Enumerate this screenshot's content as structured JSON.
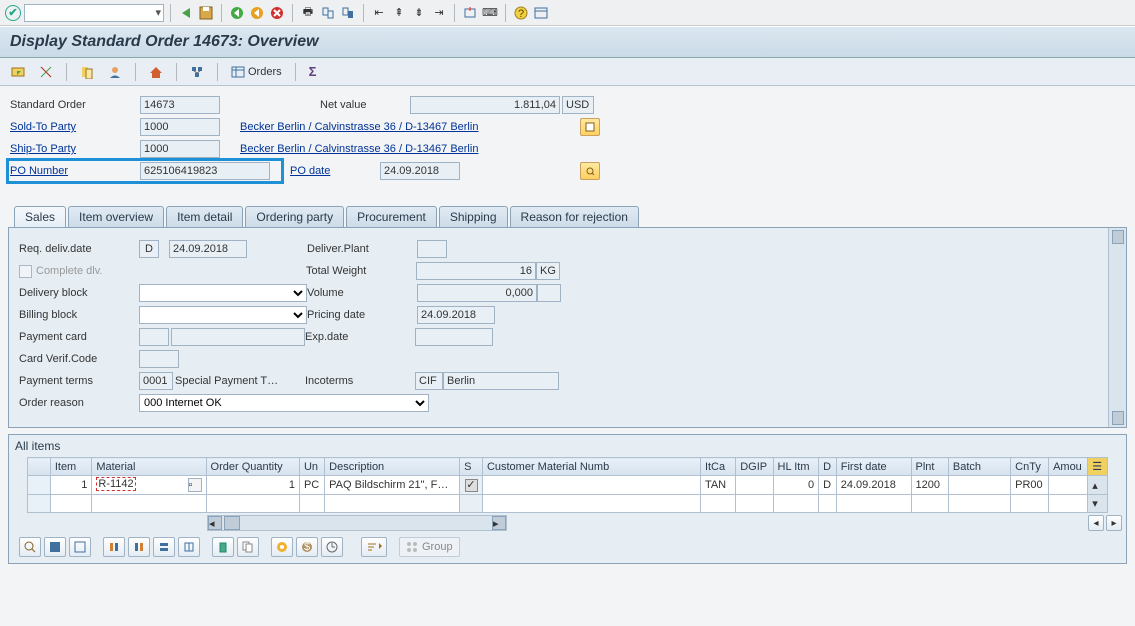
{
  "title": "Display Standard Order 14673: Overview",
  "toolbar": {
    "orders_label": "Orders"
  },
  "header": {
    "standard_order_label": "Standard Order",
    "standard_order_value": "14673",
    "net_value_label": "Net value",
    "net_value_value": "1.811,04",
    "currency": "USD",
    "sold_to_label": "Sold-To Party",
    "sold_to_value": "1000",
    "sold_to_text": "Becker Berlin / Calvinstrasse 36 / D-13467 Berlin",
    "ship_to_label": "Ship-To Party",
    "ship_to_value": "1000",
    "ship_to_text": "Becker Berlin / Calvinstrasse 36 / D-13467 Berlin",
    "po_number_label": "PO Number",
    "po_number_value": "625106419823",
    "po_date_label": "PO date",
    "po_date_value": "24.09.2018"
  },
  "tabs": [
    "Sales",
    "Item overview",
    "Item detail",
    "Ordering party",
    "Procurement",
    "Shipping",
    "Reason for rejection"
  ],
  "sales": {
    "req_deliv_label": "Req. deliv.date",
    "req_deliv_rule": "D",
    "req_deliv_date": "24.09.2018",
    "deliver_plant_label": "Deliver.Plant",
    "complete_dlv_label": "Complete dlv.",
    "total_weight_label": "Total Weight",
    "total_weight_value": "16",
    "total_weight_unit": "KG",
    "delivery_block_label": "Delivery block",
    "volume_label": "Volume",
    "volume_value": "0,000",
    "billing_block_label": "Billing block",
    "pricing_date_label": "Pricing date",
    "pricing_date_value": "24.09.2018",
    "payment_card_label": "Payment card",
    "exp_date_label": "Exp.date",
    "card_verif_label": "Card Verif.Code",
    "payment_terms_label": "Payment terms",
    "payment_terms_value": "0001",
    "payment_terms_text": "Special Payment T…",
    "incoterms_label": "Incoterms",
    "incoterms_value": "CIF",
    "incoterms_text": "Berlin",
    "order_reason_label": "Order reason",
    "order_reason_value": "000 Internet OK"
  },
  "allitems": {
    "title": "All items",
    "columns": [
      "Item",
      "Material",
      "Order Quantity",
      "Un",
      "Description",
      "S",
      "Customer Material Numb",
      "ItCa",
      "DGIP",
      "HL Itm",
      "D",
      "First date",
      "Plnt",
      "Batch",
      "CnTy",
      "Amou"
    ],
    "rows": [
      {
        "item": "1",
        "material": "R-1142",
        "qty": "1",
        "un": "PC",
        "desc": "PAQ Bildschirm  21\", F…",
        "s": "✓",
        "cust": "",
        "itca": "TAN",
        "dgip": "",
        "hlitm": "0",
        "d": "D",
        "first": "24.09.2018",
        "plnt": "1200",
        "batch": "",
        "cnty": "PR00",
        "amount": ""
      }
    ],
    "group_label": "Group"
  }
}
